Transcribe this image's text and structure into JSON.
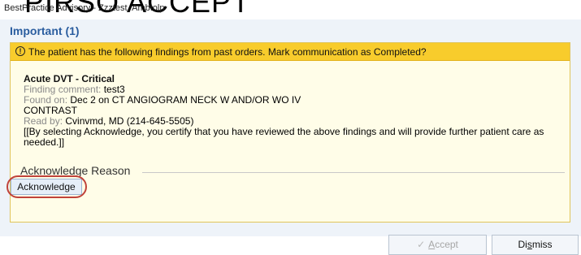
{
  "window": {
    "title_ghost": "PIRSO ACCEPT",
    "title": "BestPractice Advisory - Zzztest, Ambtolp"
  },
  "section": {
    "heading": "Important (1)"
  },
  "alert": {
    "icon": "info-circle-icon",
    "message": "The patient has the following findings from past orders. Mark communication as Completed?"
  },
  "finding": {
    "title": "Acute DVT - Critical",
    "comment_label": "Finding comment:",
    "comment_value": "test3",
    "found_label": "Found on:",
    "found_value_line1": "Dec 2 on CT ANGIOGRAM NECK W AND/OR WO IV",
    "found_value_line2": "CONTRAST",
    "read_label": "Read by:",
    "read_value": "Cvinvmd, MD (214-645-5505)",
    "disclaimer_line1": "[[By selecting Acknowledge, you certify that you have reviewed the above findings and will provide further patient care as",
    "disclaimer_line2": "needed.]]"
  },
  "acknowledge": {
    "reason_label": "Acknowledge Reason",
    "button_label": "Acknowledge"
  },
  "footer": {
    "accept_icon": "✓",
    "accept_label_prefix": "A",
    "accept_label_rest": "ccept",
    "dismiss_label_pre": "Di",
    "dismiss_label_ul": "s",
    "dismiss_label_post": "miss"
  },
  "colors": {
    "heading": "#2a5d9f",
    "alert_header": "#f8cc2c",
    "alert_body": "#fffde8",
    "highlight_ring": "#c0423a"
  }
}
